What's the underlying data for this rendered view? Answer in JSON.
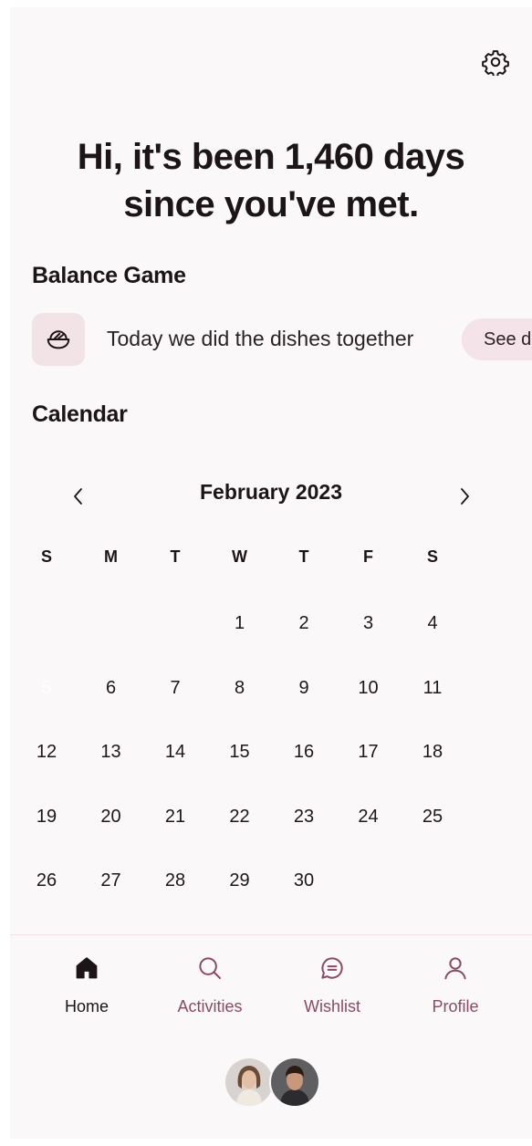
{
  "header": {
    "greeting_line1": "Hi, it's been 1,460 days",
    "greeting_line2": "since you've met."
  },
  "balance_game": {
    "title": "Balance Game",
    "icon": "rice-bowl-icon",
    "text": "Today we did the dishes together",
    "button_label": "See d"
  },
  "calendar": {
    "title": "Calendar",
    "month_label": "February 2023",
    "weekdays": [
      "S",
      "M",
      "T",
      "W",
      "T",
      "F",
      "S"
    ],
    "weeks": [
      [
        "",
        "",
        "",
        "1",
        "2",
        "3",
        "4"
      ],
      [
        "5",
        "6",
        "7",
        "8",
        "9",
        "10",
        "11"
      ],
      [
        "12",
        "13",
        "14",
        "15",
        "16",
        "17",
        "18"
      ],
      [
        "19",
        "20",
        "21",
        "22",
        "23",
        "24",
        "25"
      ],
      [
        "26",
        "27",
        "28",
        "29",
        "30",
        "",
        ""
      ]
    ],
    "selected_day": "5",
    "accent_color": "#d81f53"
  },
  "nav": {
    "items": [
      {
        "label": "Home",
        "icon": "home-icon",
        "active": true
      },
      {
        "label": "Activities",
        "icon": "search-icon",
        "active": false
      },
      {
        "label": "Wishlist",
        "icon": "chat-icon",
        "active": false
      },
      {
        "label": "Profile",
        "icon": "user-icon",
        "active": false
      }
    ],
    "inactive_color": "#8b4a63"
  }
}
